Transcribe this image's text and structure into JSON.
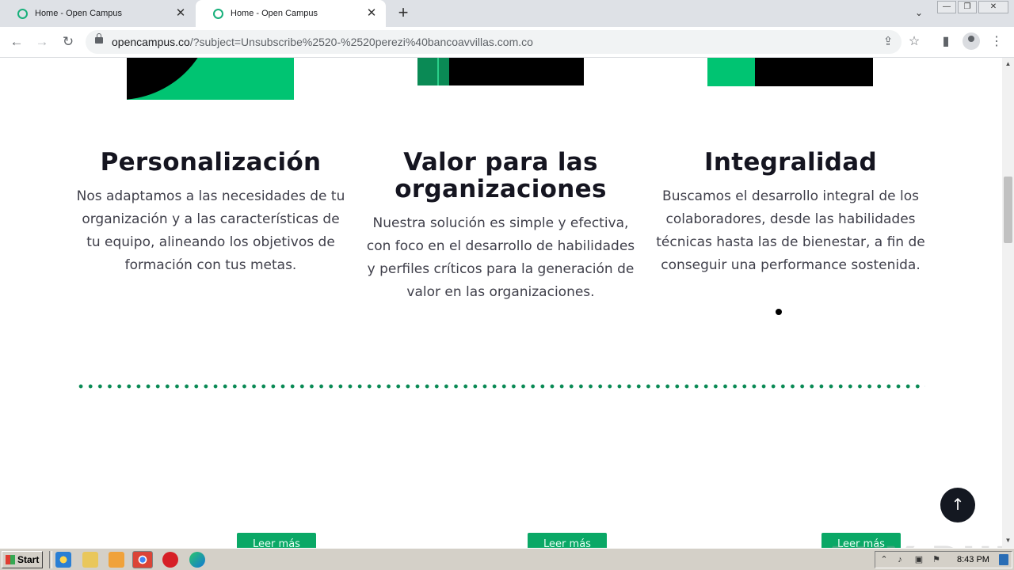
{
  "browser": {
    "tabs": [
      {
        "title": "Home - Open Campus",
        "active": false
      },
      {
        "title": "Home - Open Campus",
        "active": true
      }
    ],
    "url_domain": "opencampus.co",
    "url_rest": "/?subject=Unsubscribe%2520-%2520perezi%40bancoavvillas.com.co",
    "icons": {
      "back": "←",
      "forward": "→",
      "reload": "↻",
      "close": "✕",
      "new_tab": "+",
      "dropdown": "⌄",
      "share": "⇪",
      "star": "☆",
      "sidepanel": "▮",
      "menu": "⋮",
      "minimize": "—",
      "restore": "❐",
      "win_close": "✕"
    }
  },
  "features": [
    {
      "title": "Personalización",
      "text": "Nos adaptamos a las necesidades de tu organización y a las características de tu equipo, alineando los objetivos de formación con tus metas."
    },
    {
      "title": "Valor para las organizaciones",
      "text": "Nuestra solución es simple y efectiva, con foco en el desarrollo de habilidades y perfiles críticos para la generación de valor en las organizaciones."
    },
    {
      "title": "Integralidad",
      "text": "Buscamos el desarrollo integral de los colaboradores, desde las habilidades técnicas hasta las de bienestar, a fin de conseguir una performance sostenida."
    }
  ],
  "read_more": [
    "Leer más",
    "Leer más",
    "Leer más"
  ],
  "scroll_top_icon": "↑",
  "watermark": "ANY RUN",
  "taskbar": {
    "start_label": "Start",
    "clock": "8:43 PM"
  },
  "colors": {
    "brand_green": "#00c472",
    "dark_green": "#0a8a55",
    "button_green": "#0aa866"
  }
}
